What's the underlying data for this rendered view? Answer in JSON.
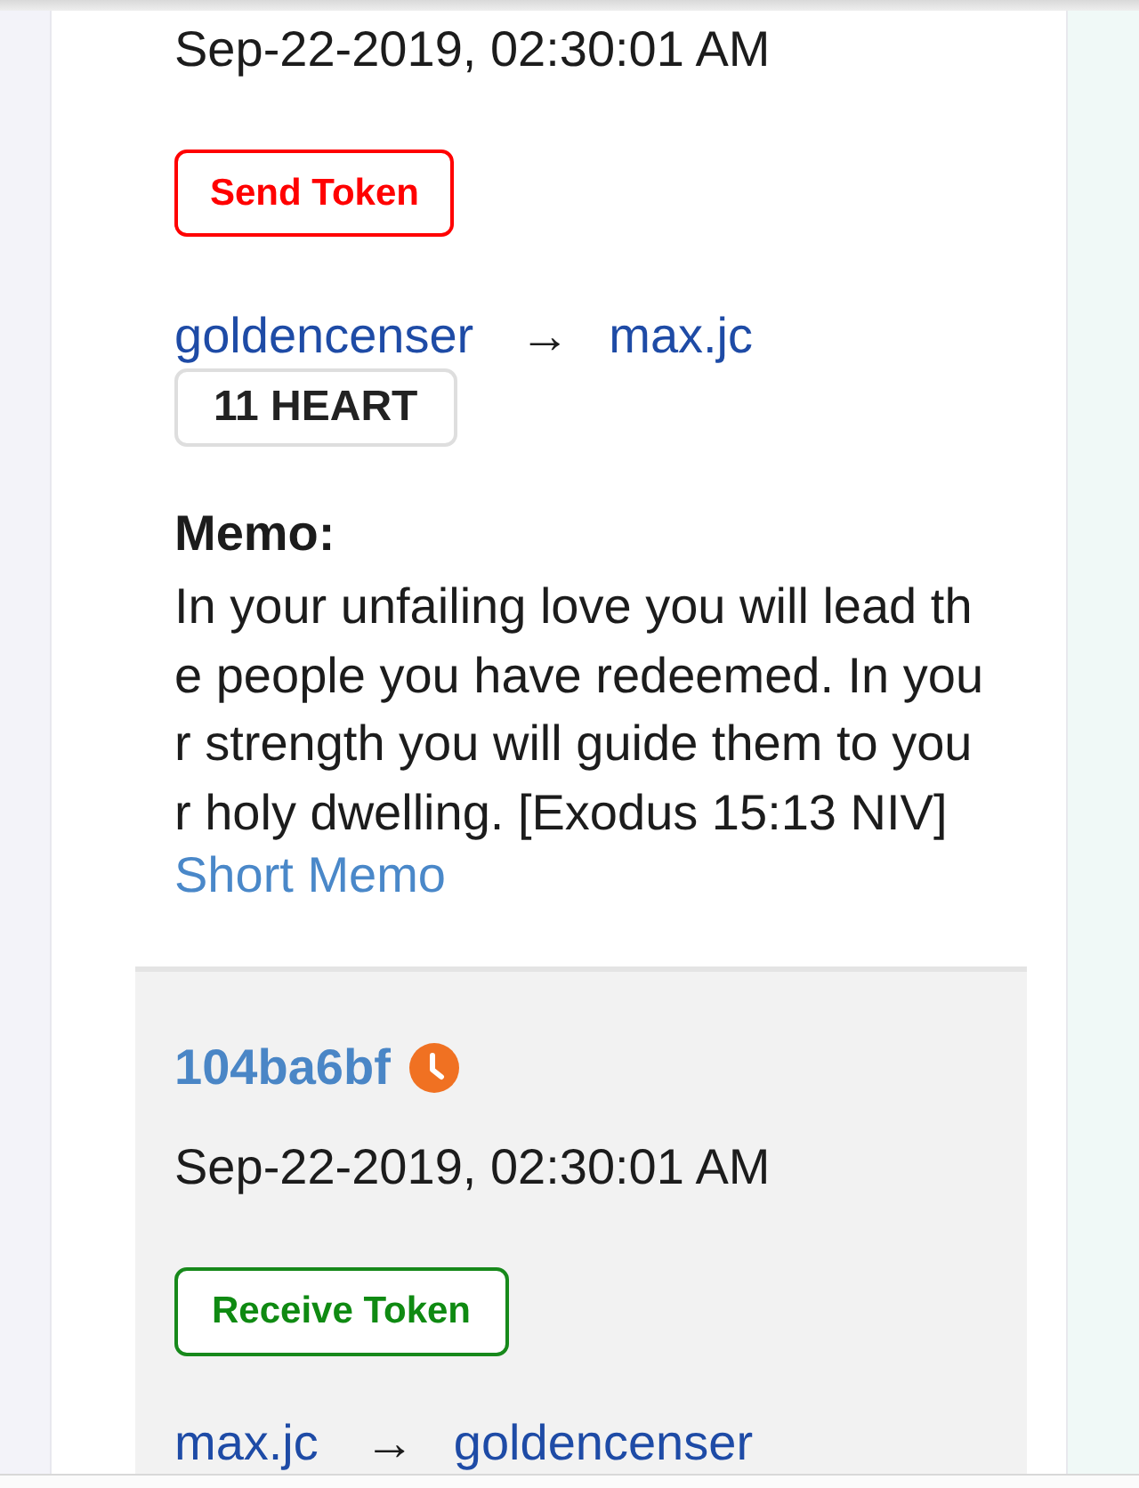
{
  "transactions": [
    {
      "highlighted": false,
      "timestamp": "Sep-22-2019, 02:30:01 AM",
      "action": {
        "kind": "send",
        "label": "Send Token"
      },
      "from": "goldencenser",
      "arrow": "→",
      "to": "max.jc",
      "amount": "11 HEART",
      "memo_label": "Memo:",
      "memo": "In your unfailing love you will lead the people you have redeemed. In your strength you will guide them to your holy dwelling. [Exodus 15:13 NIV]",
      "memo_toggle": "Short Memo"
    },
    {
      "highlighted": true,
      "txid": "104ba6bf",
      "pending": true,
      "timestamp": "Sep-22-2019, 02:30:01 AM",
      "action": {
        "kind": "receive",
        "label": "Receive Token"
      },
      "from": "max.jc",
      "arrow": "→",
      "to": "goldencenser"
    }
  ]
}
